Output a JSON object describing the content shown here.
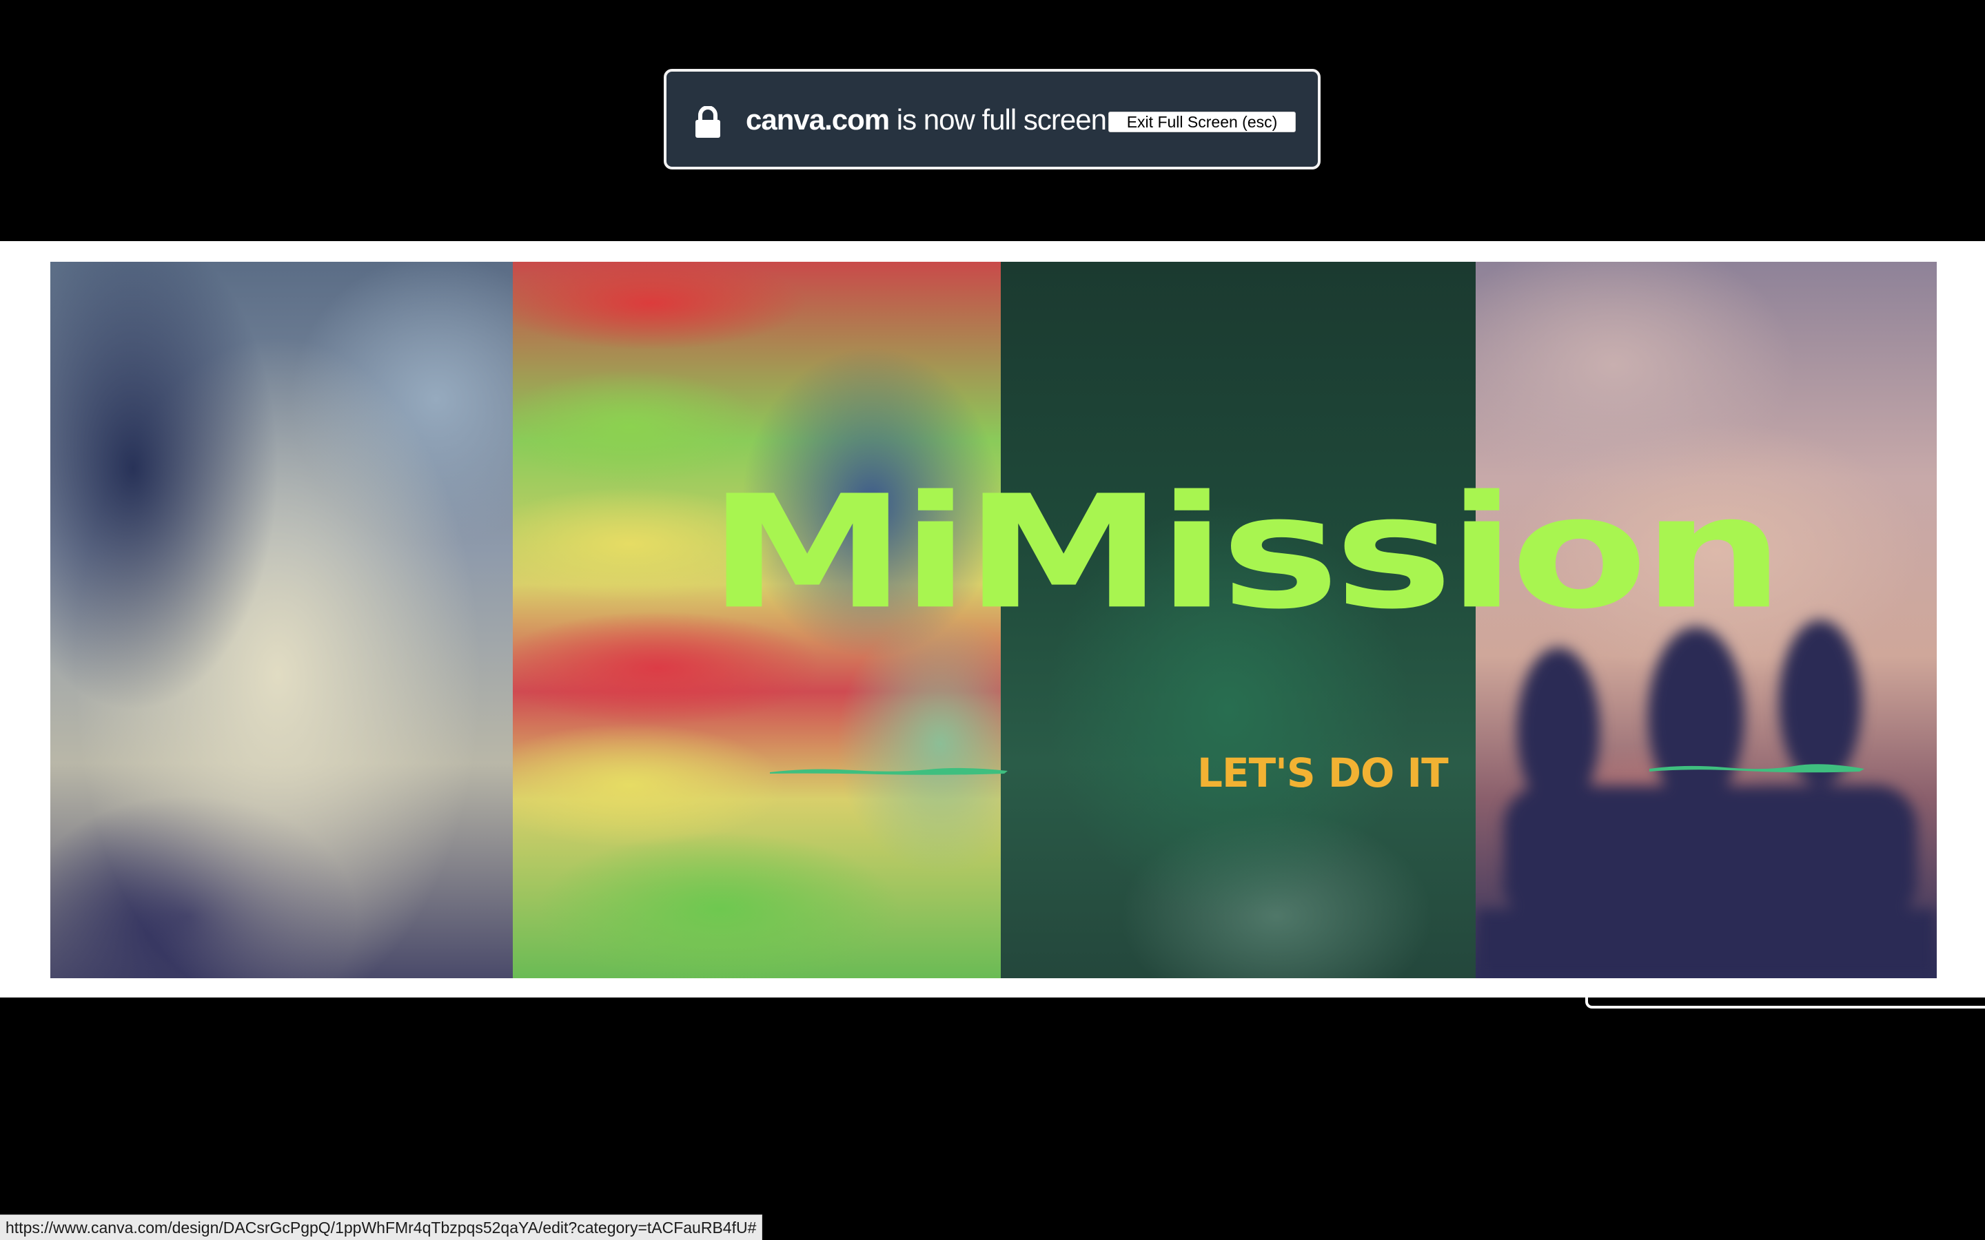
{
  "notification": {
    "domain": "canva.com",
    "message": " is now full screen",
    "exit_button_label": "Exit Full Screen (esc)"
  },
  "slide": {
    "title": "MiMission",
    "subtitle": "LET'S DO IT",
    "colors": {
      "title": "#a8f550",
      "subtitle": "#f2b233",
      "brush": "#3fbf7f"
    }
  },
  "status_bar": {
    "url": "https://www.canva.com/design/DACsrGcPgpQ/1ppWhFMr4qTbzpqs52qaYA/edit?category=tACFauRB4fU#"
  }
}
